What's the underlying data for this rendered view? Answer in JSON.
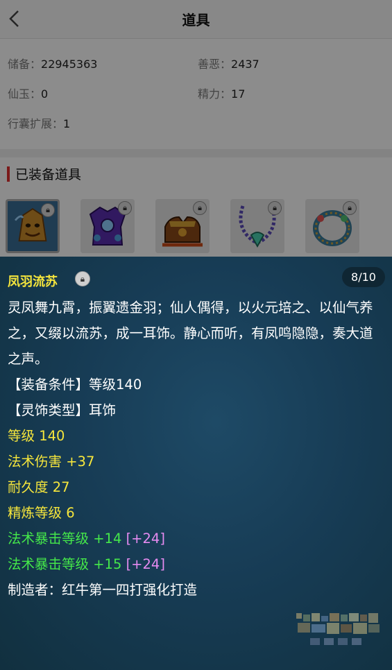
{
  "header": {
    "title": "道具"
  },
  "stats": [
    {
      "label": "储备：",
      "value": "22945363"
    },
    {
      "label": "善恶：",
      "value": "2437"
    },
    {
      "label": "仙玉：",
      "value": "0"
    },
    {
      "label": "精力：",
      "value": "17"
    },
    {
      "label": "行囊扩展：",
      "value": "1"
    }
  ],
  "section": {
    "title": "已装备道具"
  },
  "equipped_items": [
    {
      "icon": "golden-helmet-item-icon",
      "lock_icon": "lock-icon",
      "selected": true
    },
    {
      "icon": "purple-armor-item-icon",
      "lock_icon": "lock-icon",
      "selected": false
    },
    {
      "icon": "boots-item-icon",
      "lock_icon": "lock-icon",
      "selected": false
    },
    {
      "icon": "necklace-item-icon",
      "lock_icon": "lock-icon",
      "selected": false
    },
    {
      "icon": "ring-item-icon",
      "lock_icon": "lock-icon",
      "selected": false
    }
  ],
  "tooltip": {
    "name": "凤羽流苏",
    "badge": "8/10",
    "description": "灵凤舞九霄，振翼遗金羽；仙人偶得，以火元培之、以仙气养之，又缀以流苏，成一耳饰。静心而听，有凤鸣隐隐，奏大道之声。",
    "requirement": "【装备条件】等级140",
    "type_line": "【灵饰类型】耳饰",
    "attributes": [
      "等级 140",
      "法术伤害 +37",
      "耐久度 27",
      "精炼等级 6"
    ],
    "bonus_lines": [
      {
        "text": "法术暴击等级 +14 ",
        "bracket": "[+24]"
      },
      {
        "text": "法术暴击等级 +15 ",
        "bracket": "[+24]"
      }
    ],
    "maker": "制造者：红牛第一四打强化打造"
  },
  "colors": {
    "accent_red": "#e03030",
    "name_yellow": "#f6e63c",
    "attr_green": "#45e84a",
    "bonus_pink": "#e58bf0",
    "panel_bg": "#173c55"
  }
}
